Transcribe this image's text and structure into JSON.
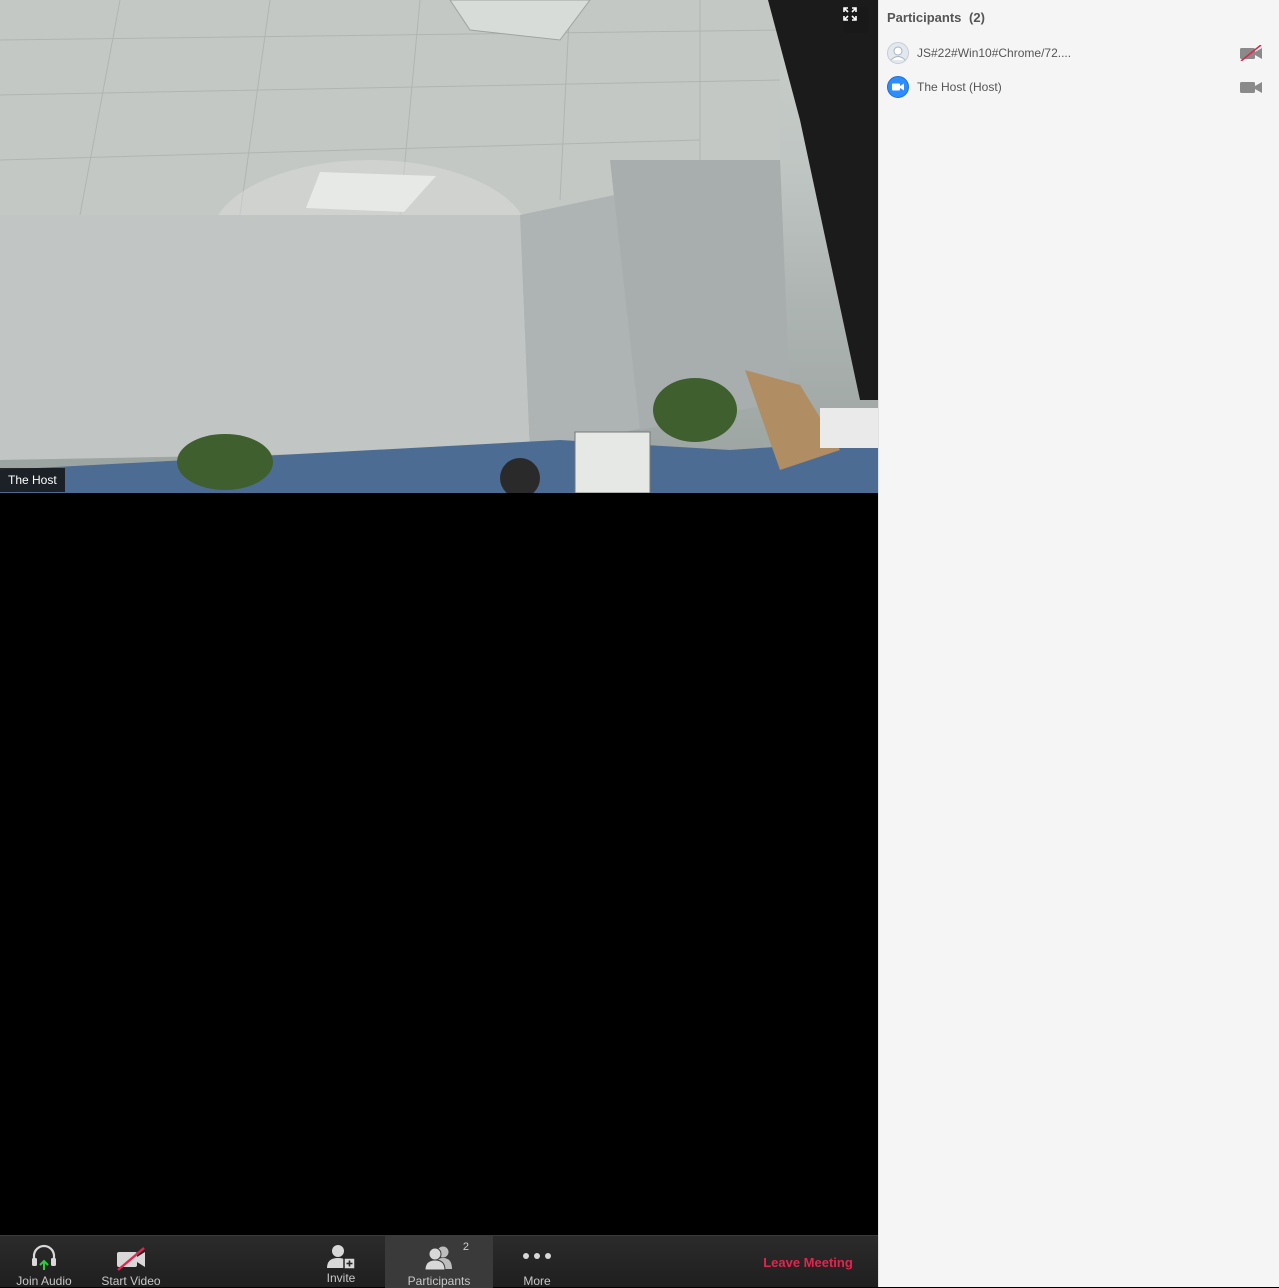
{
  "video": {
    "host_name_tag": "The Host"
  },
  "toolbar": {
    "join_audio_label": "Join Audio",
    "start_video_label": "Start Video",
    "invite_label": "Invite",
    "participants_label": "Participants",
    "participants_count": "2",
    "more_label": "More",
    "leave_label": "Leave Meeting",
    "leave_color": "#e0264f"
  },
  "panel": {
    "title": "Participants",
    "count": "(2)",
    "participants": [
      {
        "name": "JS#22#Win10#Chrome/72....",
        "avatar_icon": "default-user-avatar-icon",
        "video_icon": "video-off-icon"
      },
      {
        "name": "The Host (Host)",
        "avatar_icon": "zoom-host-avatar-icon",
        "video_icon": "video-on-icon"
      }
    ]
  },
  "colors": {
    "accent_blue": "#2d8cff",
    "toolbar_bg": "#232323",
    "panel_bg": "#f5f5f5"
  }
}
